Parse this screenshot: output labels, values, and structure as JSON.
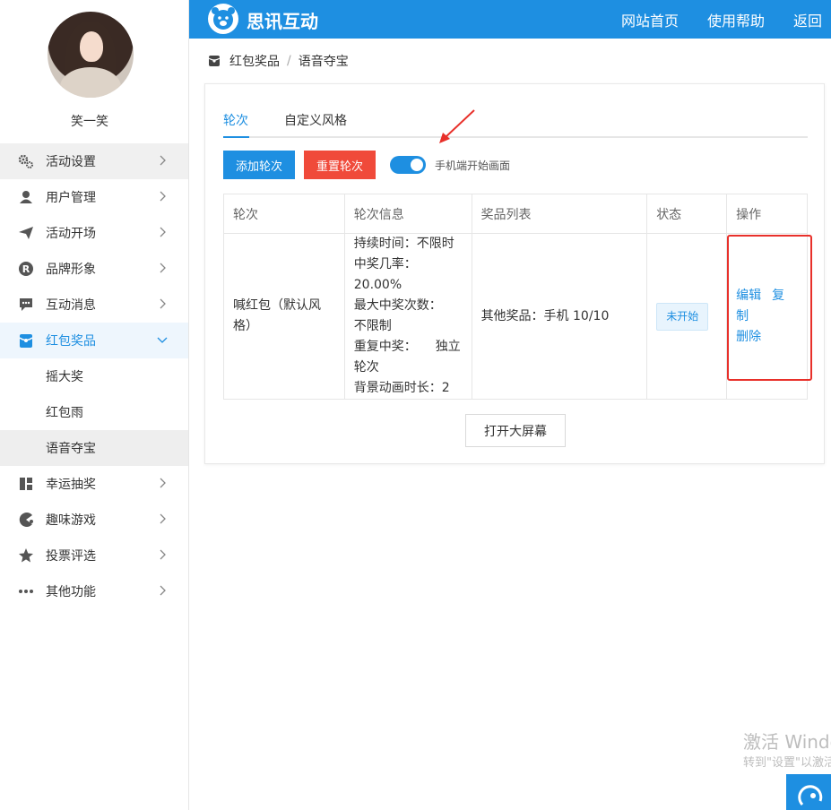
{
  "user": {
    "name": "笑一笑"
  },
  "sidebar": {
    "items": [
      {
        "label": "活动设置",
        "icon": "gears-icon"
      },
      {
        "label": "用户管理",
        "icon": "user-icon"
      },
      {
        "label": "活动开场",
        "icon": "paper-plane-icon"
      },
      {
        "label": "品牌形象",
        "icon": "registered-icon"
      },
      {
        "label": "互动消息",
        "icon": "chat-bubble-icon"
      },
      {
        "label": "红包奖品",
        "icon": "red-envelope-icon"
      },
      {
        "label": "幸运抽奖",
        "icon": "gift-icon"
      },
      {
        "label": "趣味游戏",
        "icon": "game-icon"
      },
      {
        "label": "投票评选",
        "icon": "star-icon"
      },
      {
        "label": "其他功能",
        "icon": "more-dots-icon"
      }
    ],
    "sub_items": [
      "摇大奖",
      "红包雨",
      "语音夺宝"
    ]
  },
  "header": {
    "brand": "思讯互动",
    "nav": [
      "网站首页",
      "使用帮助",
      "返回"
    ]
  },
  "breadcrumb": {
    "parent": "红包奖品",
    "separator": "/",
    "current": "语音夺宝"
  },
  "tabs": [
    "轮次",
    "自定义风格"
  ],
  "toolbar": {
    "add_label": "添加轮次",
    "reset_label": "重置轮次",
    "toggle_label": "手机端开始画面",
    "toggle_on": true
  },
  "table": {
    "headers": [
      "轮次",
      "轮次信息",
      "奖品列表",
      "状态",
      "操作"
    ],
    "rows": [
      {
        "round": "喊红包（默认风格）",
        "info": [
          "持续时间：不限时",
          "中奖几率：20.00%",
          "最大中奖次数：　　不限制",
          "重复中奖：　　独立轮次",
          "背景动画时长：2"
        ],
        "prizes": "其他奖品：手机 10/10",
        "status": "未开始",
        "ops": [
          "编辑",
          "复制",
          "删除"
        ]
      }
    ]
  },
  "big_screen_label": "打开大屏幕",
  "watermark": {
    "line1": "激活 Windows",
    "line2": "转到\"设置\"以激活 Windows。"
  },
  "colors": {
    "primary": "#1e8fe1",
    "danger": "#f04a3a",
    "annotation": "#e8302a"
  }
}
